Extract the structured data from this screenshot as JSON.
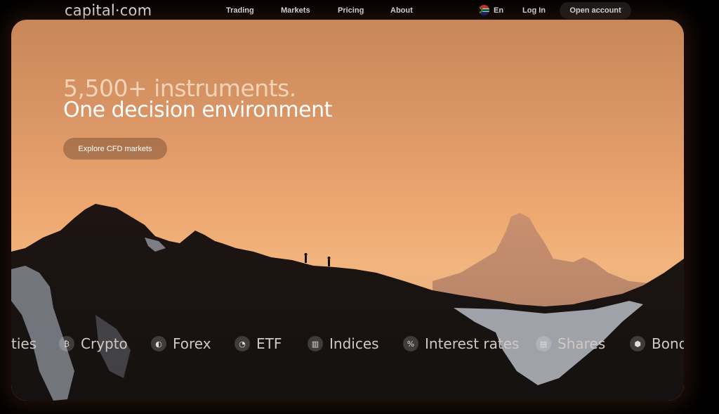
{
  "brand": {
    "logo_text": "capital·com"
  },
  "nav": [
    {
      "label": "Trading"
    },
    {
      "label": "Markets"
    },
    {
      "label": "Pricing"
    },
    {
      "label": "About"
    }
  ],
  "header": {
    "language": "En",
    "login_label": "Log In",
    "open_account_label": "Open account"
  },
  "hero": {
    "headline_line1": "5,500+ instruments.",
    "headline_line2": "One decision environment",
    "cta_label": "Explore CFD markets"
  },
  "ticker": [
    {
      "label": "ties",
      "icon": "none"
    },
    {
      "label": "Crypto",
      "icon": "crypto-icon"
    },
    {
      "label": "Forex",
      "icon": "forex-icon"
    },
    {
      "label": "ETF",
      "icon": "etf-icon"
    },
    {
      "label": "Indices",
      "icon": "indices-icon"
    },
    {
      "label": "Interest rates",
      "icon": "interest-rates-icon"
    },
    {
      "label": "Shares",
      "icon": "shares-icon"
    },
    {
      "label": "Bond",
      "icon": "bonds-icon"
    }
  ],
  "colors": {
    "sky_top": "#c88759",
    "sky_bottom": "#f2b57e",
    "open_button_bg": "#1b1b1b"
  }
}
